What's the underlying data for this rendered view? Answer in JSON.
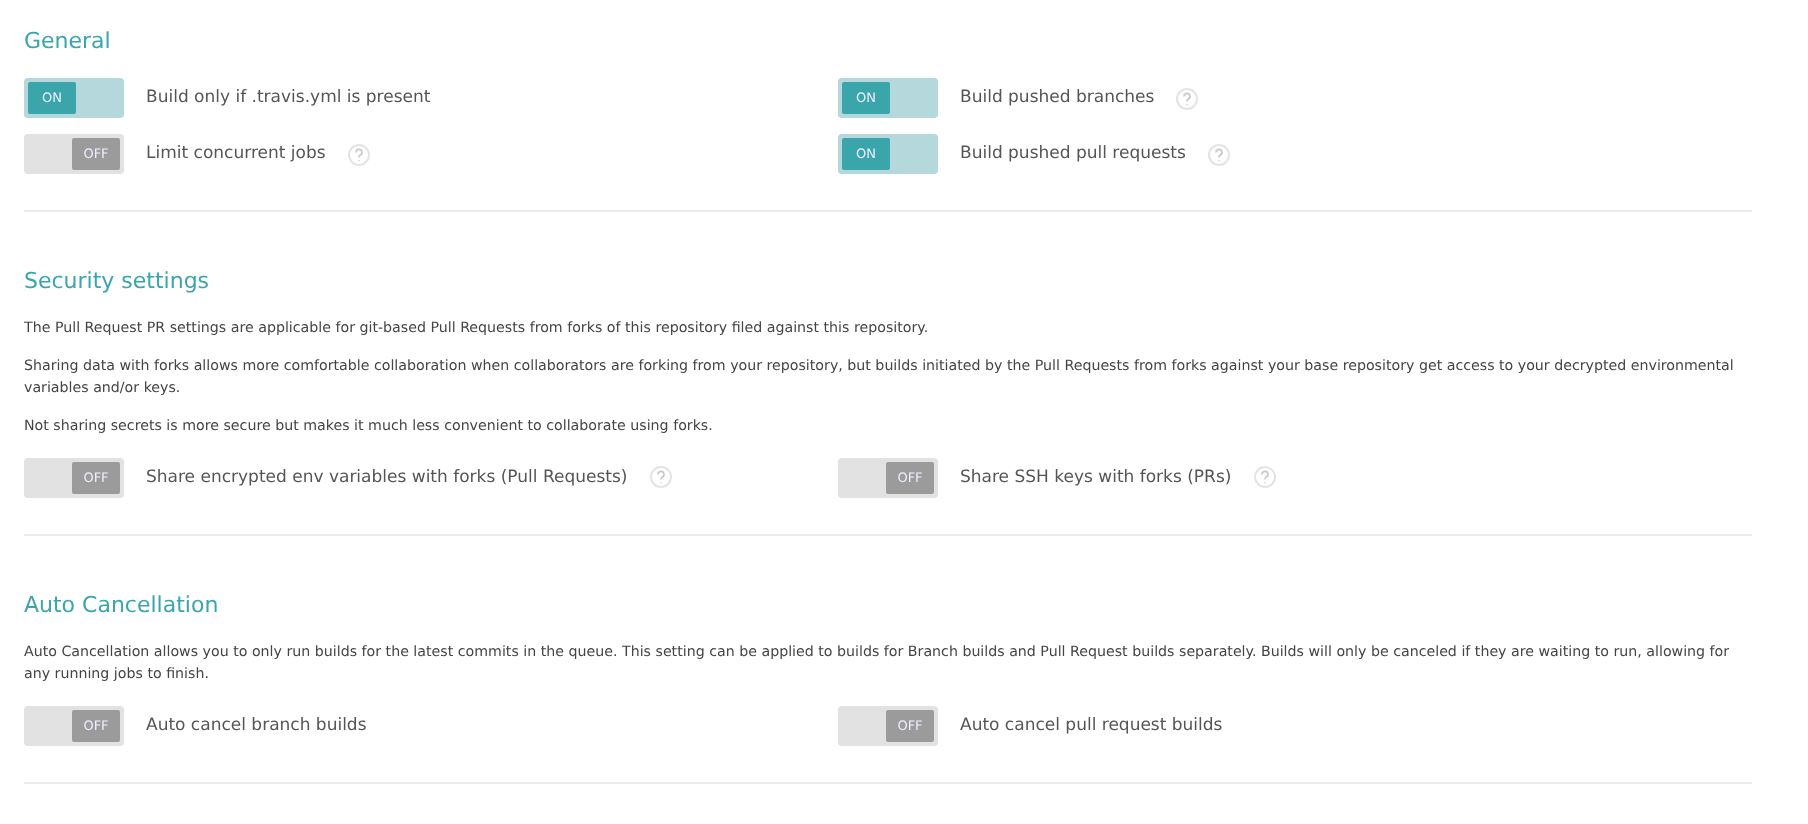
{
  "sections": [
    {
      "title": "General",
      "settings": [
        {
          "label": "Build only if .travis.yml is present",
          "on": true,
          "switch_text": "ON",
          "help": false
        },
        {
          "label": "Build pushed branches",
          "on": true,
          "switch_text": "ON",
          "help": true
        },
        {
          "label": "Limit concurrent jobs",
          "on": false,
          "switch_text": "OFF",
          "help": true
        },
        {
          "label": "Build pushed pull requests",
          "on": true,
          "switch_text": "ON",
          "help": true
        }
      ]
    },
    {
      "title": "Security settings",
      "paragraphs": [
        "The Pull Request PR settings are applicable for git-based Pull Requests from forks of this repository filed against this repository.",
        "Sharing data with forks allows more comfortable collaboration when collaborators are forking from your repository, but builds initiated by the Pull Requests from forks against your base repository get access to your decrypted environmental variables and/or keys.",
        "Not sharing secrets is more secure but makes it much less convenient to collaborate using forks."
      ],
      "settings": [
        {
          "label": "Share encrypted env variables with forks (Pull Requests)",
          "on": false,
          "switch_text": "OFF",
          "help": true
        },
        {
          "label": "Share SSH keys with forks (PRs)",
          "on": false,
          "switch_text": "OFF",
          "help": true
        }
      ]
    },
    {
      "title": "Auto Cancellation",
      "paragraphs": [
        "Auto Cancellation allows you to only run builds for the latest commits in the queue. This setting can be applied to builds for Branch builds and Pull Request builds separately. Builds will only be canceled if they are waiting to run, allowing for any running jobs to finish."
      ],
      "settings": [
        {
          "label": "Auto cancel branch builds",
          "on": false,
          "switch_text": "OFF",
          "help": false
        },
        {
          "label": "Auto cancel pull request builds",
          "on": false,
          "switch_text": "OFF",
          "help": false
        }
      ]
    }
  ]
}
